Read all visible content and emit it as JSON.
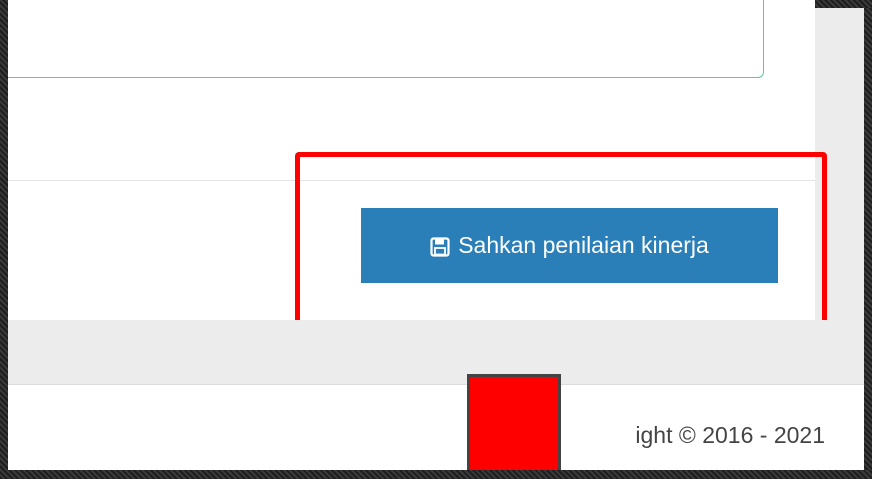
{
  "form": {
    "submit_label": "Sahkan penilaian kinerja",
    "submit_icon": "floppy-disk-icon"
  },
  "footer": {
    "copyright_text": "ight © 2016 - 2021"
  },
  "colors": {
    "primary_button": "#2a7fb8",
    "field_border": "#5ec6a9",
    "highlight": "#ff0000",
    "redaction": "#ff0000"
  }
}
